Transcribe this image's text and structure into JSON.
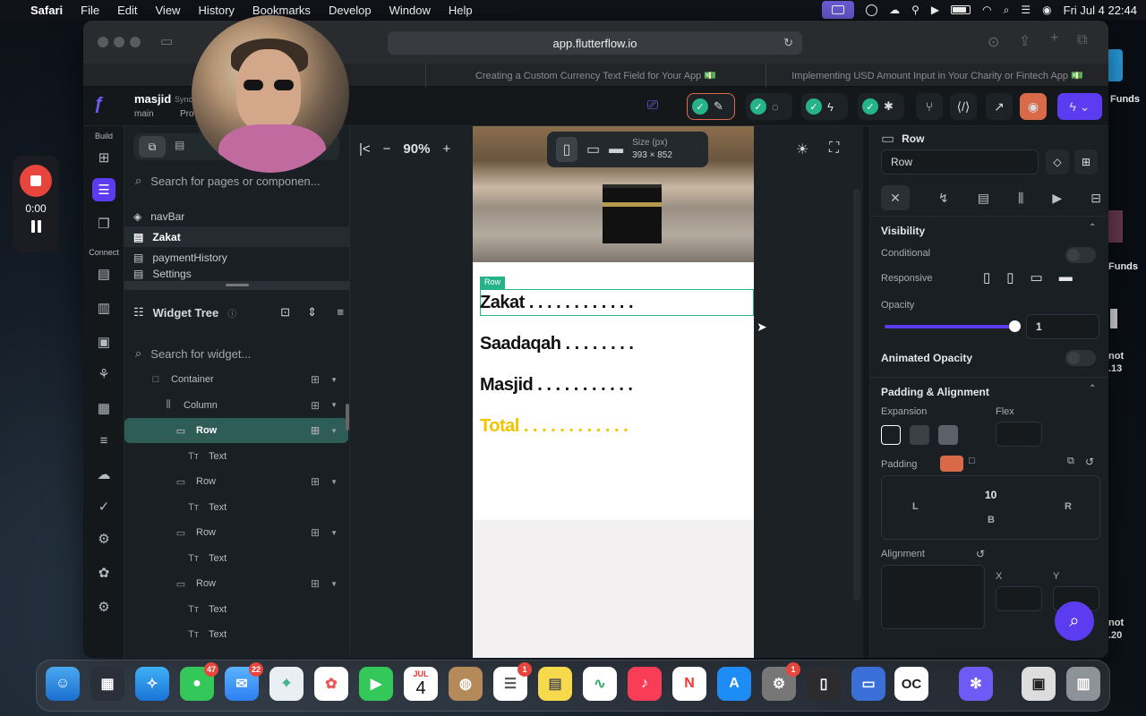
{
  "menubar": {
    "app": "Safari",
    "items": [
      "File",
      "Edit",
      "View",
      "History",
      "Bookmarks",
      "Develop",
      "Window",
      "Help"
    ],
    "clock": "Fri Jul 4  22:44"
  },
  "recorder": {
    "time": "0:00"
  },
  "browser": {
    "url": "app.flutterflow.io",
    "tabs": [
      "Creating a Custom Currency Text Field for Your App 💵",
      "Implementing USD Amount Input in Your Charity or Fintech App 💵"
    ]
  },
  "project": {
    "name": "masjid",
    "sync": "Sync",
    "branch": "main",
    "branch_suffix": "Pro"
  },
  "rail": {
    "build_label": "Build",
    "connect_label": "Connect"
  },
  "pages": {
    "search_placeholder": "Search for pages or componen...",
    "items": [
      "navBar",
      "Zakat",
      "paymentHistory",
      "Settings"
    ],
    "selected": "Zakat"
  },
  "widget_tree": {
    "title": "Widget Tree",
    "search_placeholder": "Search for widget...",
    "items": [
      {
        "label": "Container",
        "indent": 1,
        "icon": "container"
      },
      {
        "label": "Column",
        "indent": 2,
        "icon": "column"
      },
      {
        "label": "Row",
        "indent": 3,
        "icon": "row",
        "selected": true
      },
      {
        "label": "Text",
        "indent": 4,
        "icon": "text"
      },
      {
        "label": "Row",
        "indent": 3,
        "icon": "row"
      },
      {
        "label": "Text",
        "indent": 4,
        "icon": "text"
      },
      {
        "label": "Row",
        "indent": 3,
        "icon": "row"
      },
      {
        "label": "Text",
        "indent": 4,
        "icon": "text"
      },
      {
        "label": "Row",
        "indent": 3,
        "icon": "row"
      },
      {
        "label": "Text",
        "indent": 4,
        "icon": "text"
      },
      {
        "label": "Text",
        "indent": 4,
        "icon": "text"
      }
    ]
  },
  "canvas": {
    "zoom": "90%",
    "size_label": "Size (px)",
    "size_value": "393 × 852",
    "row_tag": "Row",
    "lines": [
      {
        "text": "Zakat . . . . . . . . . . . .",
        "color": "#111111"
      },
      {
        "text": "Saadaqah . . . . . . . .",
        "color": "#111111"
      },
      {
        "text": "Masjid . . . . . . . . . . .",
        "color": "#111111"
      },
      {
        "text": "Total . . . . . . . . . . . .",
        "color": "#f2c400"
      }
    ]
  },
  "properties": {
    "widget": "Row",
    "name_value": "Row",
    "visibility": {
      "title": "Visibility",
      "conditional": "Conditional",
      "responsive": "Responsive",
      "opacity": "Opacity",
      "opacity_value": "1",
      "animated_opacity": "Animated Opacity"
    },
    "padding": {
      "title": "Padding & Alignment",
      "expansion": "Expansion",
      "flex": "Flex",
      "padding": "Padding",
      "top": "10",
      "left": "L",
      "right": "R",
      "bottom": "B",
      "alignment": "Alignment",
      "x": "X",
      "y": "Y"
    }
  },
  "desktop_right": {
    "funds1": "Funds",
    "funds2": "Funds",
    "not1": "not",
    "v1": ".13",
    "not2": "not",
    "v2": ".20"
  },
  "dock": {
    "badges": {
      "messages": "47",
      "mail": "22",
      "reminders": "1",
      "settings": "1"
    },
    "calendar_month": "JUL",
    "calendar_day": "4",
    "oc": "OC"
  },
  "colors": {
    "accent": "#27b38a",
    "flutterflow_purple": "#5b3cf0",
    "total_yellow": "#f2c400",
    "recording_red": "#e8463c"
  }
}
